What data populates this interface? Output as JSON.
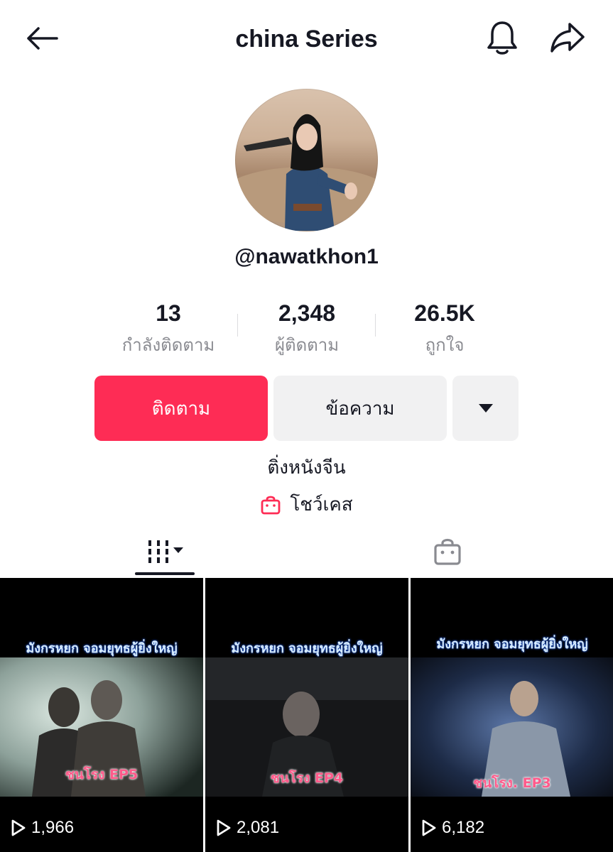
{
  "header": {
    "title": "china Series"
  },
  "profile": {
    "username": "@nawatkhon1",
    "bio": "ติ่งหนังจีน",
    "showcase": "โชว์เคส"
  },
  "stats": [
    {
      "value": "13",
      "label": "กำลังติดตาม"
    },
    {
      "value": "2,348",
      "label": "ผู้ติดตาม"
    },
    {
      "value": "26.5K",
      "label": "ถูกใจ"
    }
  ],
  "buttons": {
    "follow": "ติดตาม",
    "message": "ข้อความ"
  },
  "colors": {
    "accent": "#fe2c55",
    "secondary_btn": "#f1f1f2"
  },
  "icons": [
    "back-arrow-icon",
    "bell-icon",
    "share-icon",
    "dropdown-icon",
    "shopping-bag-icon",
    "video-grid-icon"
  ],
  "videos": [
    {
      "headline": "มังกรหยก จอมยุทธผู้ยิ่งใหญ่",
      "episode": "ชนโรง EP5",
      "views": "1,966"
    },
    {
      "headline": "มังกรหยก จอมยุทธผู้ยิ่งใหญ่",
      "episode": "ชนโรง EP4",
      "views": "2,081"
    },
    {
      "headline": "มังกรหยก จอมยุทธผู้ยิ่งใหญ่",
      "episode": "ชนโรง. EP3",
      "views": "6,182"
    }
  ]
}
